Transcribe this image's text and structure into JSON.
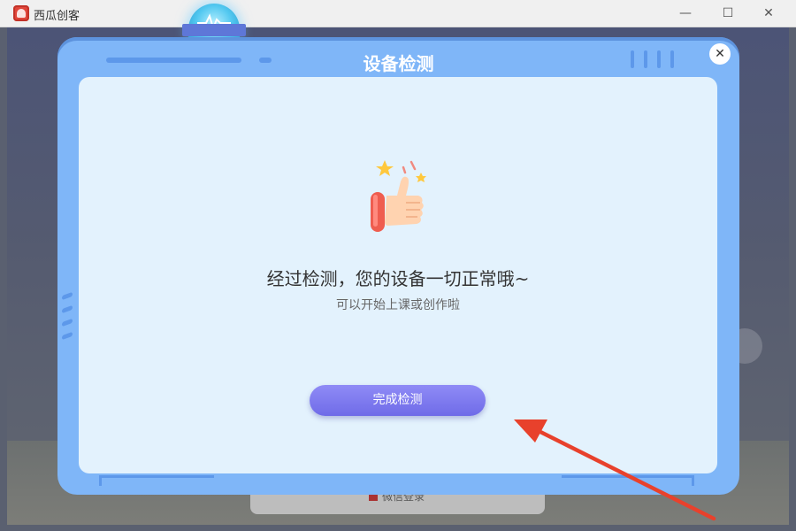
{
  "window": {
    "app_title": "西瓜创客",
    "minimize_glyph": "—",
    "maximize_glyph": "☐",
    "close_glyph": "✕"
  },
  "background": {
    "login_label": "微信登录"
  },
  "dialog": {
    "title": "设备检测",
    "close_glyph": "✕",
    "message": "经过检测，您的设备一切正常哦~",
    "sub_message": "可以开始上课或创作啦",
    "finish_button": "完成检测",
    "icon": "thumbs-up-icon"
  },
  "colors": {
    "dialog_frame": "#7fb6f8",
    "inner_panel": "#e3f2fd",
    "button": "#7773ee",
    "annotation_arrow": "#e8412c"
  }
}
